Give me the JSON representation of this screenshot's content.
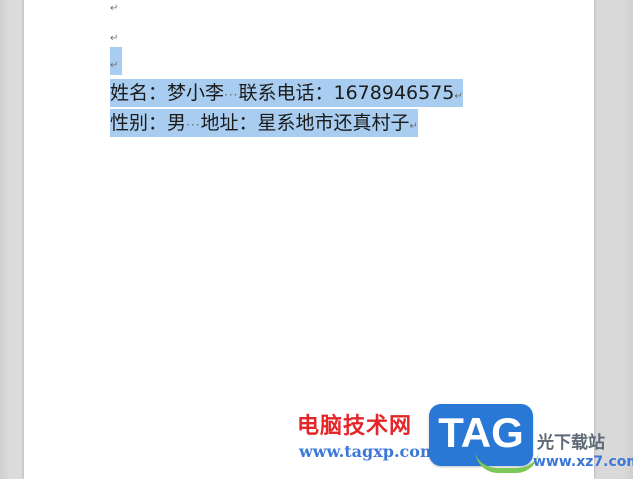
{
  "document": {
    "empty_paragraph_mark": "↵",
    "line1": {
      "label1": "姓名：",
      "value1": "梦小李",
      "spaces1": "···",
      "label2": "联系电话：",
      "value2": "1678946575",
      "mark": "↵"
    },
    "line2": {
      "label1": "性别：",
      "value1": "男",
      "spaces1": "···",
      "label2": "地址：",
      "value2": "星系地市还真村子",
      "mark": "↵"
    }
  },
  "watermark": {
    "cn_text": "电脑技术网",
    "url": "www.tagxp.com",
    "logo_text": "TAG",
    "right_cn": "光下载站",
    "right_url": "www.xz7.com"
  },
  "colors": {
    "selection": "#a8cdf0",
    "page": "#ffffff",
    "background": "#d7d7d7"
  }
}
